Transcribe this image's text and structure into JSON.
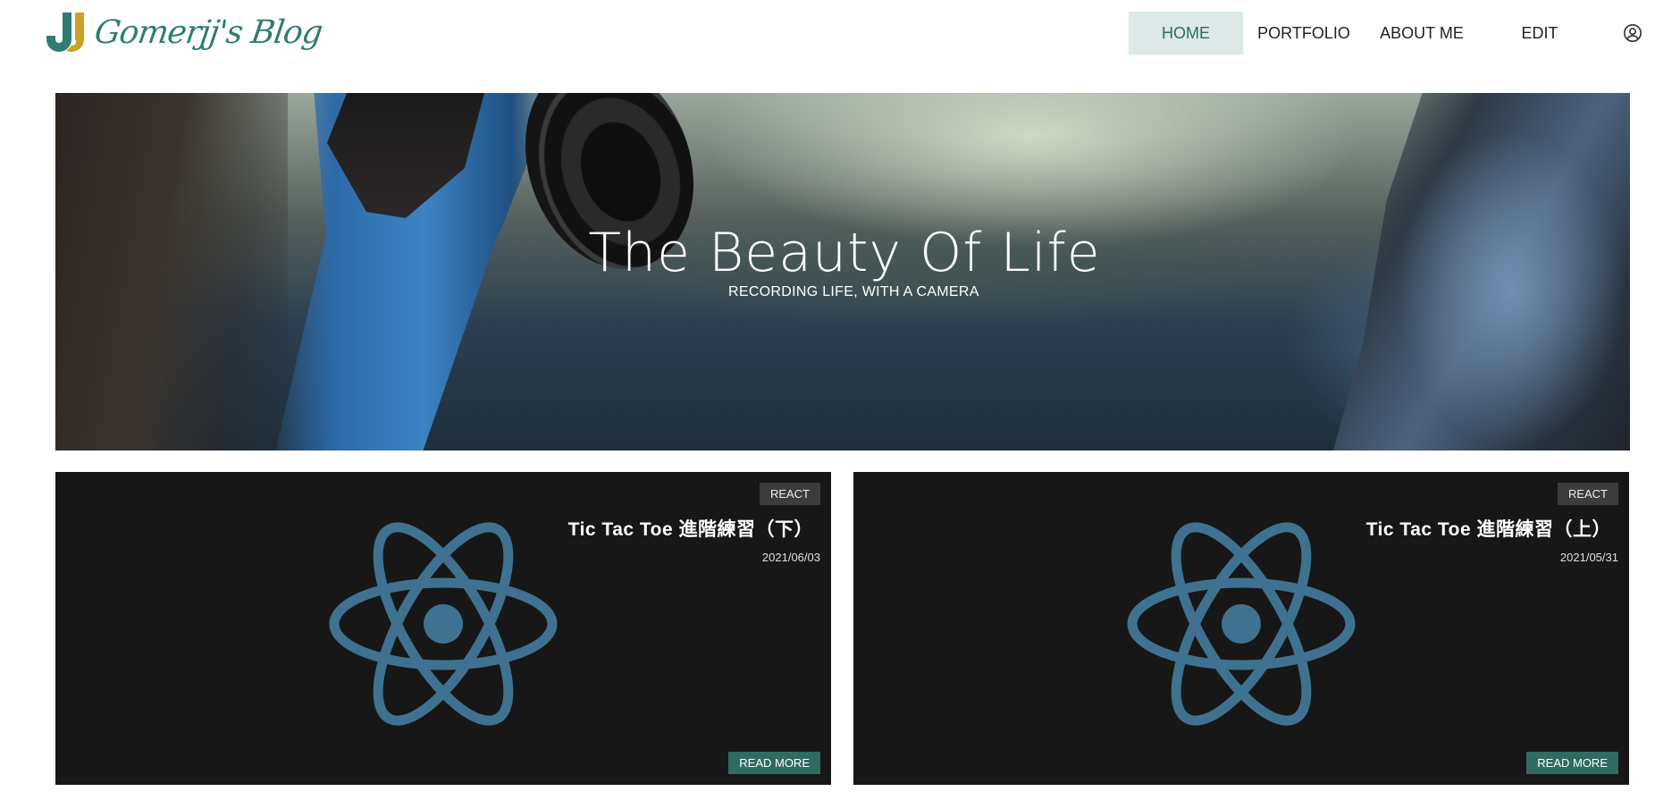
{
  "header": {
    "logo_text": "Gomerjj's Blog",
    "logo_mark": "JJ",
    "nav": {
      "home": "HOME",
      "portfolio": "PORTFOLIO",
      "about": "ABOUT ME",
      "edit": "EDIT",
      "account_icon": "user-circle-icon"
    }
  },
  "hero": {
    "title": "The Beauty Of Life",
    "subtitle": "RECORDING LIFE, WITH A CAMERA"
  },
  "posts": [
    {
      "tag": "REACT",
      "title": "Tic Tac Toe 進階練習（下）",
      "date": "2021/06/03",
      "button": "READ MORE",
      "icon": "react-logo-icon"
    },
    {
      "tag": "REACT",
      "title": "Tic Tac Toe 進階練習（上）",
      "date": "2021/05/31",
      "button": "READ MORE",
      "icon": "react-logo-icon"
    }
  ],
  "colors": {
    "accent": "#2f6b62",
    "nav_active_bg": "#dde9e8",
    "card_bg": "#171717",
    "react_icon": "#3f7290",
    "logo_teal": "#2f7d72",
    "logo_gold": "#c9a227"
  }
}
